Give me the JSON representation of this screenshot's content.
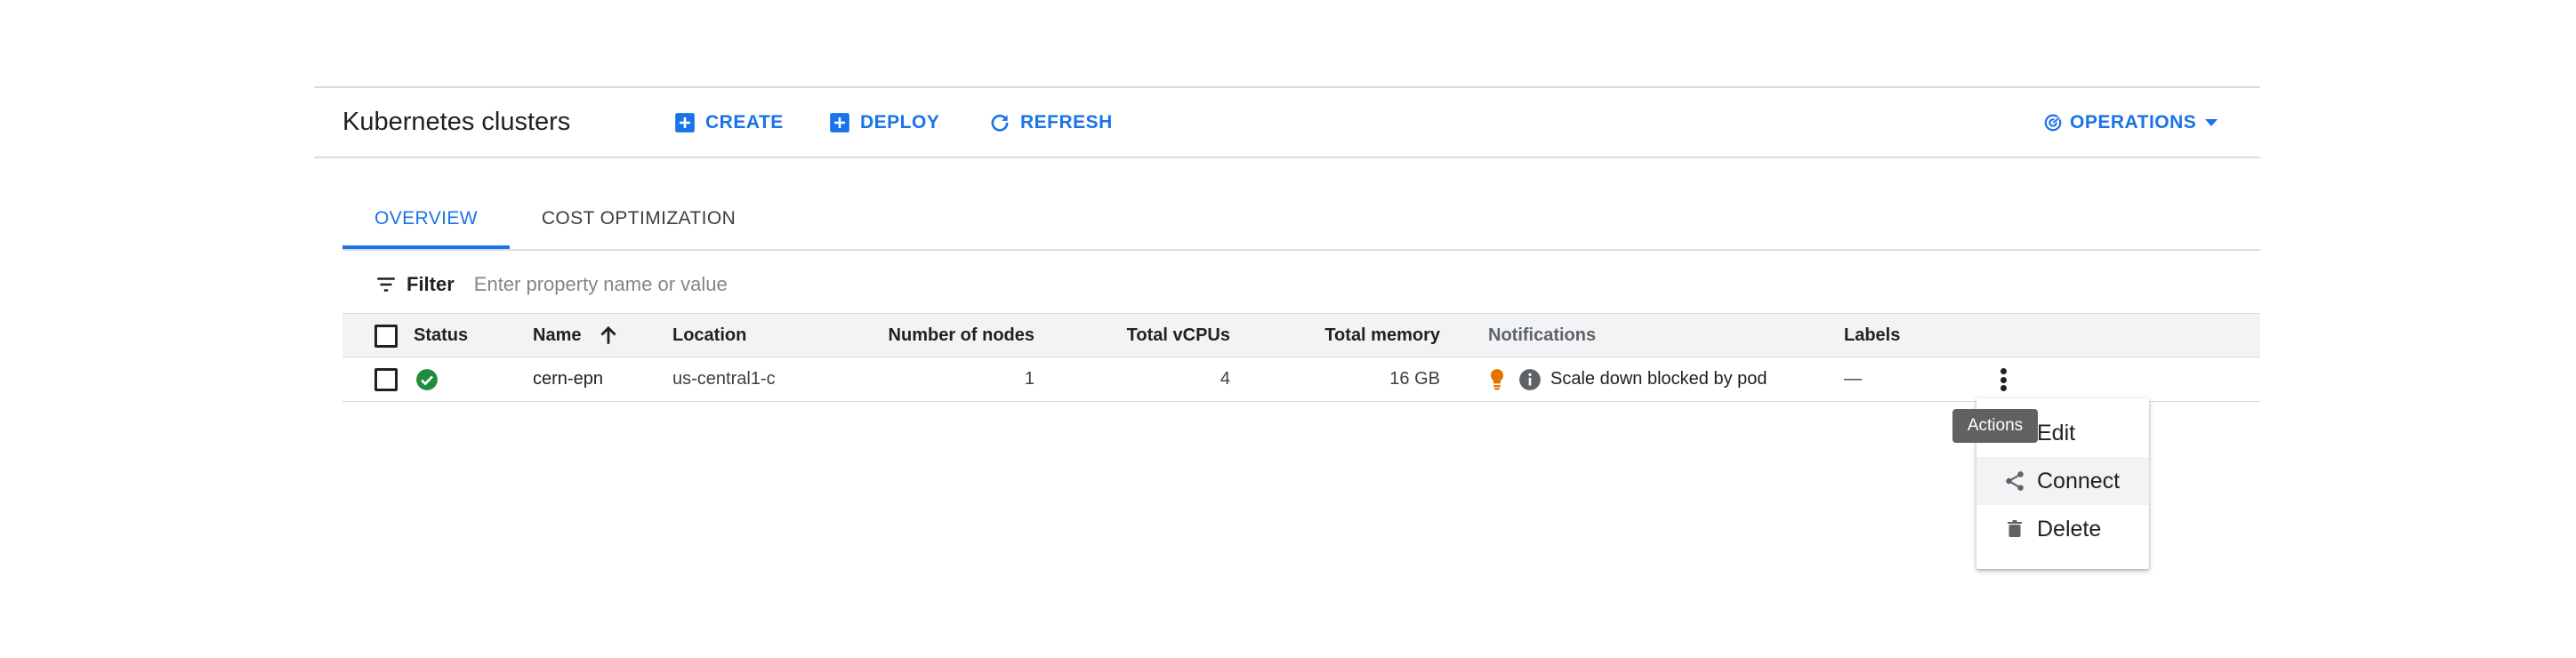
{
  "toolbar": {
    "title": "Kubernetes clusters",
    "create_label": "CREATE",
    "deploy_label": "DEPLOY",
    "refresh_label": "REFRESH",
    "operations_label": "OPERATIONS"
  },
  "tabs": [
    {
      "label": "OVERVIEW",
      "active": true
    },
    {
      "label": "COST OPTIMIZATION",
      "active": false
    }
  ],
  "filter": {
    "label": "Filter",
    "placeholder": "Enter property name or value"
  },
  "table": {
    "headers": {
      "status": "Status",
      "name": "Name",
      "location": "Location",
      "nodes": "Number of nodes",
      "vcpus": "Total vCPUs",
      "memory": "Total memory",
      "notifications": "Notifications",
      "labels": "Labels"
    },
    "rows": [
      {
        "status": "ok",
        "name": "cern-epn",
        "location": "us-central1-c",
        "nodes": "1",
        "vcpus": "4",
        "memory": "16 GB",
        "notification": "Scale down blocked by pod",
        "labels": "—"
      }
    ]
  },
  "actions_menu": {
    "tooltip": "Actions",
    "items": [
      {
        "label": "Edit",
        "icon": "edit-icon"
      },
      {
        "label": "Connect",
        "icon": "connect-icon"
      },
      {
        "label": "Delete",
        "icon": "trash-icon"
      }
    ]
  },
  "colors": {
    "accent": "#1a73e8",
    "status_ok": "#1e8e3e",
    "bulb": "#e37400",
    "border": "#dadce0",
    "header_bg": "#f1f3f4",
    "tooltip_bg": "#616161"
  }
}
